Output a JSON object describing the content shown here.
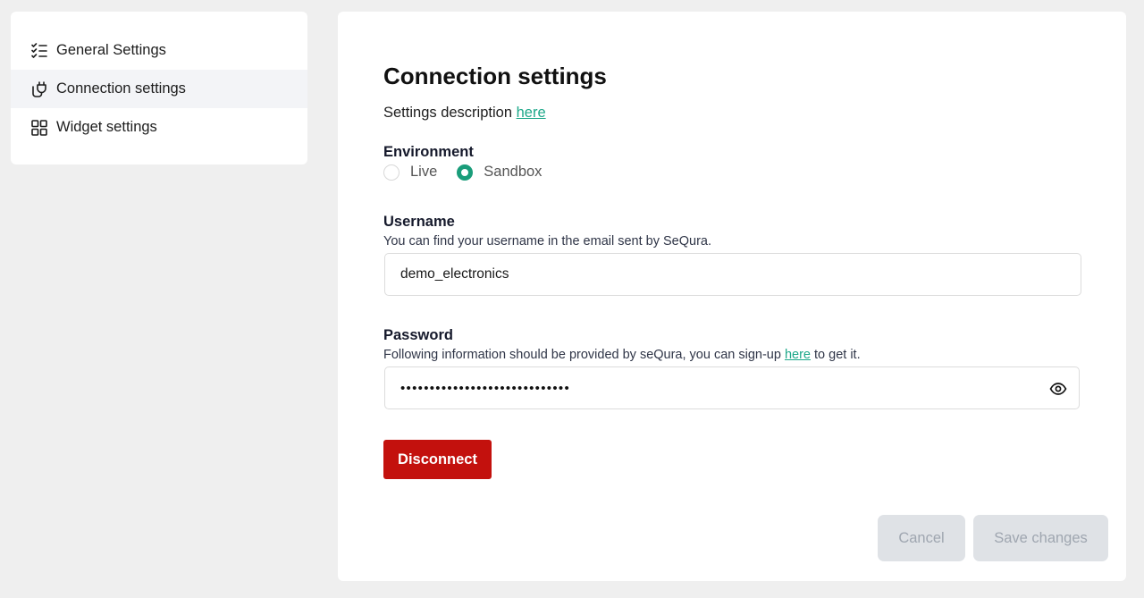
{
  "sidebar": {
    "items": [
      {
        "label": "General Settings",
        "icon": "checklist-icon"
      },
      {
        "label": "Connection settings",
        "icon": "plug-icon",
        "active": true
      },
      {
        "label": "Widget settings",
        "icon": "grid-icon"
      }
    ]
  },
  "main": {
    "title": "Connection settings",
    "description": "Settings description ",
    "description_link": "here",
    "environment": {
      "label": "Environment",
      "options": [
        "Live",
        "Sandbox"
      ],
      "selected": "Sandbox"
    },
    "username": {
      "label": "Username",
      "help": "You can find your username in the email sent by SeQura.",
      "value": "demo_electronics"
    },
    "password": {
      "label": "Password",
      "help_before": "Following information should be provided by seQura, you can sign-up ",
      "help_link": "here",
      "help_after": " to get it.",
      "masked_value": "•••••••••••••••••••••••••••••"
    },
    "disconnect_label": "Disconnect",
    "cancel_label": "Cancel",
    "save_label": "Save changes"
  },
  "colors": {
    "accent": "#1a9d7a",
    "link": "#1ea88a",
    "danger": "#c3110d",
    "disabled_bg": "#dfe2e6"
  }
}
